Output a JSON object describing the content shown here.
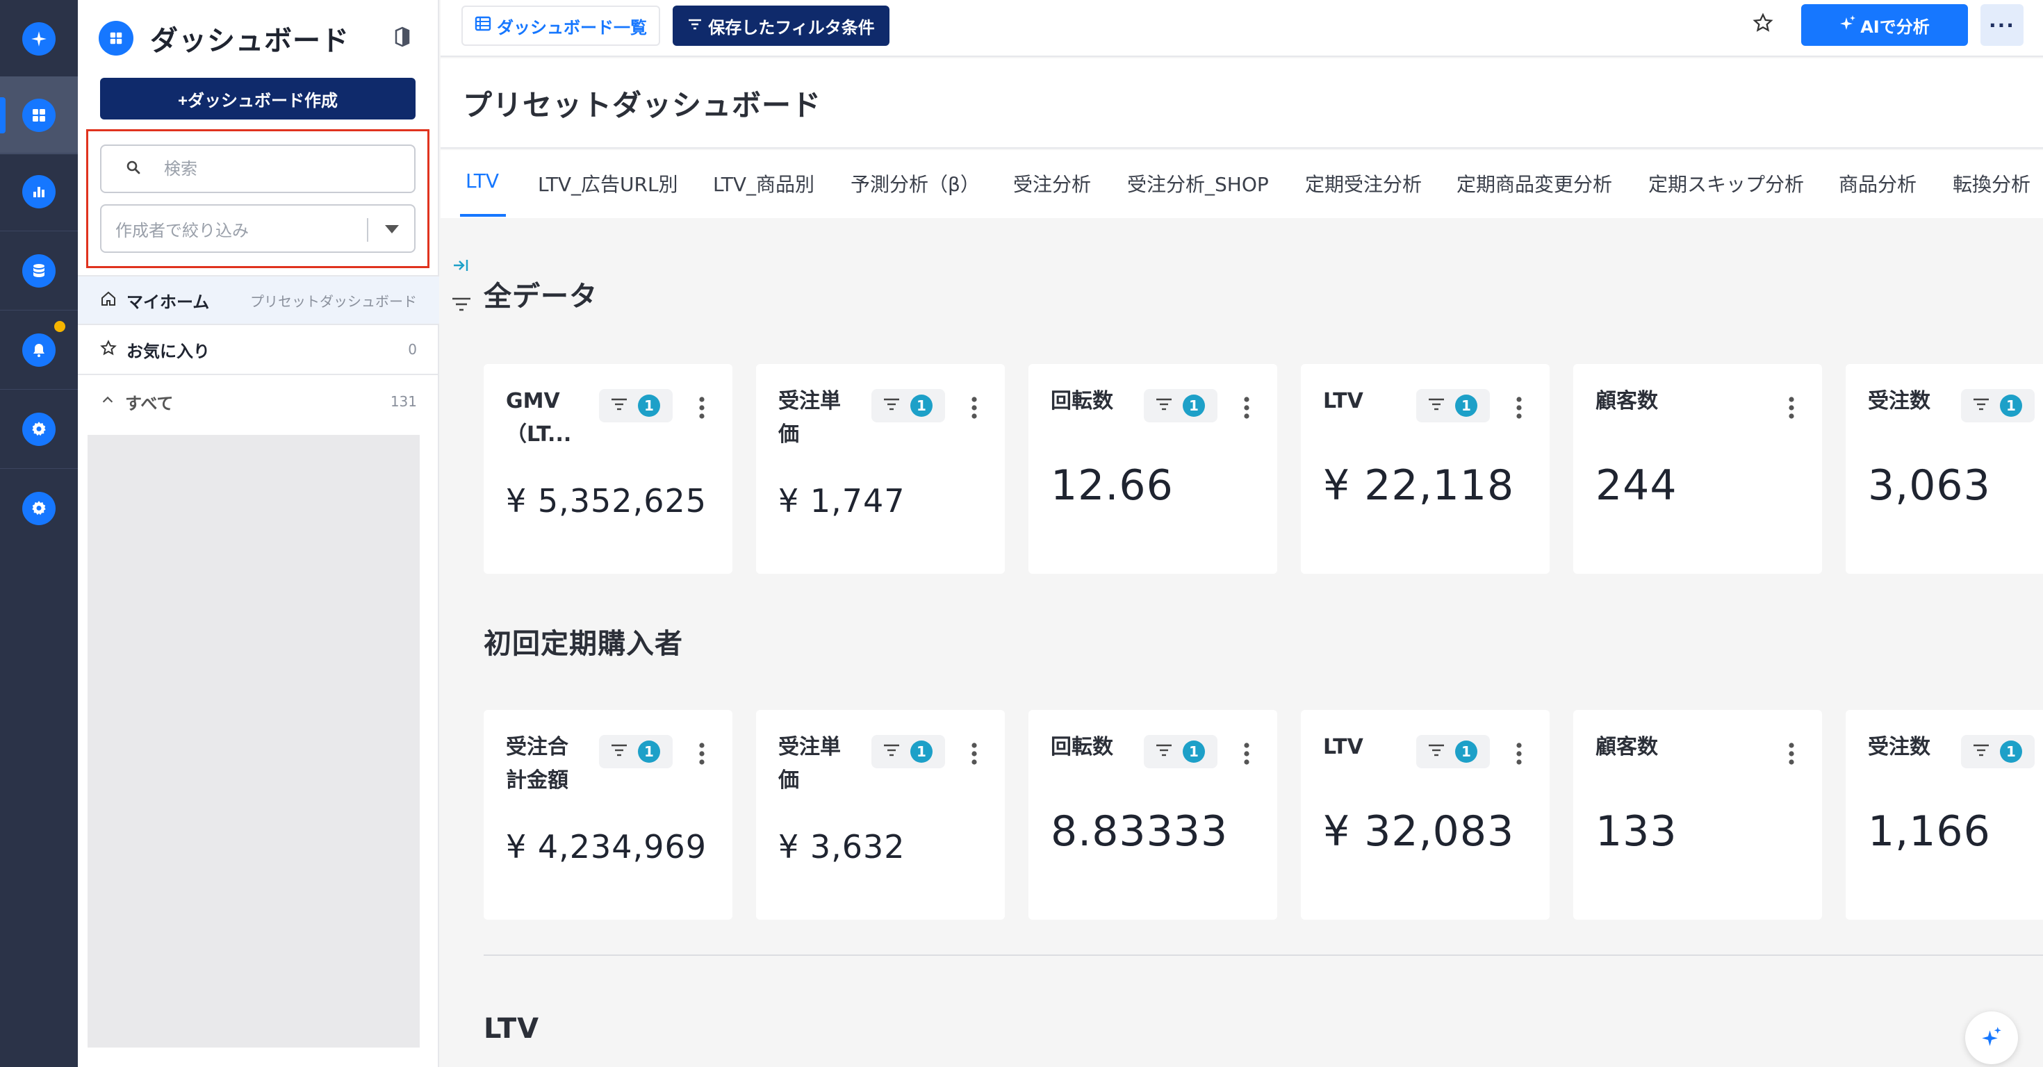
{
  "colors": {
    "accent": "#1677ff",
    "navy": "#0f2a6b",
    "rail": "#2b3348",
    "badge": "#1da0c8",
    "highlight": "#e0331e",
    "notify": "#f5b400"
  },
  "sidebar": {
    "title": "ダッシュボード",
    "create_label": "+ダッシュボード作成",
    "search_placeholder": "検索",
    "author_placeholder": "作成者で絞り込み",
    "nav": [
      {
        "label": "マイホーム",
        "meta": "プリセットダッシュボード",
        "icon": "home-icon"
      },
      {
        "label": "お気に入り",
        "meta": "0",
        "icon": "star-icon"
      },
      {
        "label": "すべて",
        "meta": "131",
        "icon": "chevron-up-icon"
      }
    ]
  },
  "topbar": {
    "list_label": "ダッシュボード一覧",
    "saved_filter_label": "保存したフィルタ条件",
    "ai_label": "AIで分析",
    "more_label": "···"
  },
  "page": {
    "title": "プリセットダッシュボード"
  },
  "tabs": [
    "LTV",
    "LTV_広告URL別",
    "LTV_商品別",
    "予測分析（β）",
    "受注分析",
    "受注分析_SHOP",
    "定期受注分析",
    "定期商品変更分析",
    "定期スキップ分析",
    "商品分析",
    "転換分析"
  ],
  "active_tab": "LTV",
  "sections": [
    {
      "title": "全データ",
      "cards": [
        {
          "title": "GMV（LT...",
          "filter_count": "1",
          "value": "¥ 5,352,625"
        },
        {
          "title": "受注単価",
          "filter_count": "1",
          "value": "¥ 1,747"
        },
        {
          "title": "回転数",
          "filter_count": "1",
          "value": "12.66"
        },
        {
          "title": "LTV",
          "filter_count": "1",
          "value": "¥ 22,118"
        },
        {
          "title": "顧客数",
          "filter_count": null,
          "value": "244"
        },
        {
          "title": "受注数",
          "filter_count": "1",
          "value": "3,063"
        }
      ]
    },
    {
      "title": "初回定期購入者",
      "cards": [
        {
          "title": "受注合計金額",
          "filter_count": "1",
          "value": "¥ 4,234,969"
        },
        {
          "title": "受注単価",
          "filter_count": "1",
          "value": "¥ 3,632"
        },
        {
          "title": "回転数",
          "filter_count": "1",
          "value": "8.83333"
        },
        {
          "title": "LTV",
          "filter_count": "1",
          "value": "¥ 32,083"
        },
        {
          "title": "顧客数",
          "filter_count": null,
          "value": "133"
        },
        {
          "title": "受注数",
          "filter_count": "1",
          "value": "1,166"
        }
      ]
    },
    {
      "title": "LTV"
    }
  ]
}
